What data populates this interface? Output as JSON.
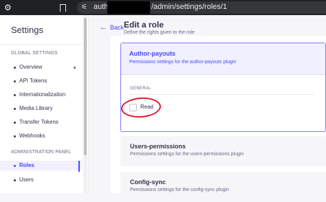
{
  "browser": {
    "url_prefix": "auth",
    "url_path": "/admin/settings/roles/1"
  },
  "sidebar": {
    "title": "Settings",
    "sections": [
      {
        "label": "GLOBAL SETTINGS",
        "items": [
          "Overview",
          "API Tokens",
          "Internationalization",
          "Media Library",
          "Transfer Tokens",
          "Webhooks"
        ]
      },
      {
        "label": "ADMINISTRATION PANEL",
        "items": [
          "Roles",
          "Users"
        ]
      }
    ],
    "active_item": "Roles"
  },
  "header": {
    "back_label": "Back",
    "title": "Edit a role",
    "subtitle": "Define the rights given to the role"
  },
  "plugins": [
    {
      "name": "Author-payouts",
      "description": "Permissions settings for the author-payouts plugin",
      "expanded": true,
      "group_label": "GENERAL",
      "permissions": [
        {
          "label": "Read",
          "checked": false
        }
      ]
    },
    {
      "name": "Users-permissions",
      "description": "Permissions settings for the users-permissions plugin",
      "expanded": false
    },
    {
      "name": "Config-sync",
      "description": "Permissions settings for the config-sync plugin",
      "expanded": false
    }
  ],
  "colors": {
    "accent": "#4945ff",
    "annotation": "#e0182d"
  }
}
